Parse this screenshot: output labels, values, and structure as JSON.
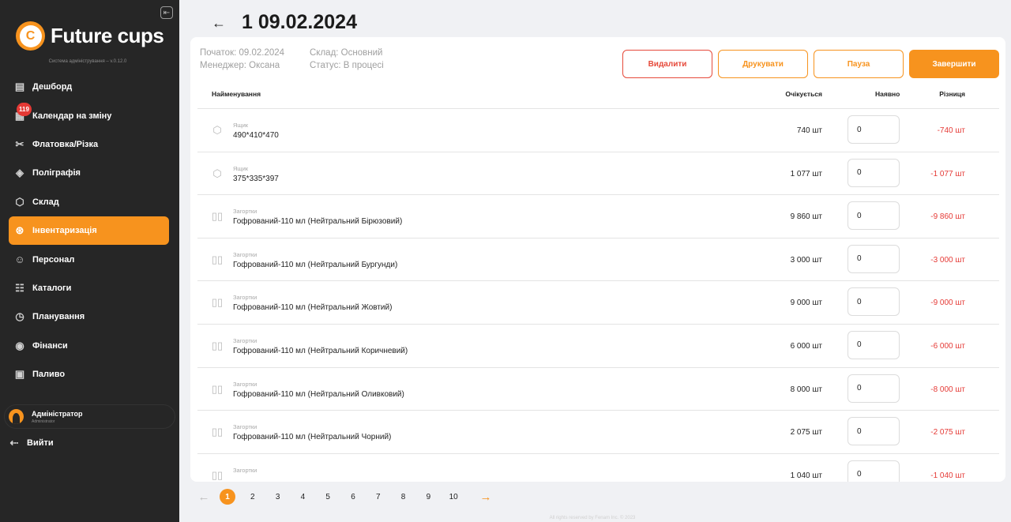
{
  "app": {
    "logo_text": "Future cups",
    "subtitle": "Система адміністрування – v.0.12.0"
  },
  "sidebar": {
    "items": [
      {
        "label": "Дешборд",
        "icon": "dashboard-icon",
        "active": false
      },
      {
        "label": "Календар на зміну",
        "icon": "calendar-icon",
        "active": false,
        "badge": "119"
      },
      {
        "label": "Флатовка/Різка",
        "icon": "scissors-icon",
        "active": false
      },
      {
        "label": "Поліграфія",
        "icon": "print-drop-icon",
        "active": false
      },
      {
        "label": "Склад",
        "icon": "box-icon",
        "active": false
      },
      {
        "label": "Інвентаризація",
        "icon": "inventory-icon",
        "active": true
      },
      {
        "label": "Персонал",
        "icon": "people-icon",
        "active": false
      },
      {
        "label": "Каталоги",
        "icon": "catalog-icon",
        "active": false
      },
      {
        "label": "Планування",
        "icon": "planning-icon",
        "active": false
      },
      {
        "label": "Фінанси",
        "icon": "finance-icon",
        "active": false
      },
      {
        "label": "Паливо",
        "icon": "fuel-icon",
        "active": false
      }
    ],
    "user": {
      "name": "Адміністратор",
      "role": "Administrator"
    },
    "logout_label": "Вийти"
  },
  "header": {
    "title": "1 09.02.2024"
  },
  "meta": {
    "start": "Початок: 09.02.2024",
    "manager": "Менеджер: Оксана",
    "warehouse": "Склад: Основний",
    "status": "Статус: В процесі"
  },
  "actions": {
    "delete": "Видалити",
    "print": "Друкувати",
    "pause": "Пауза",
    "finish": "Завершити"
  },
  "table": {
    "headers": {
      "name": "Найменування",
      "expected": "Очікується",
      "available": "Наявно",
      "diff": "Різниця"
    },
    "rows": [
      {
        "icon": "box-icon",
        "category": "Ящик",
        "name": "490*410*470",
        "expected": "740 шт",
        "available": "0",
        "diff": "-740 шт"
      },
      {
        "icon": "box-icon",
        "category": "Ящик",
        "name": "375*335*397",
        "expected": "1 077 шт",
        "available": "0",
        "diff": "-1 077 шт"
      },
      {
        "icon": "blanks-icon",
        "category": "Загортки",
        "name": "Гофрований-110 мл (Нейтральний Бірюзовий)",
        "expected": "9 860 шт",
        "available": "0",
        "diff": "-9 860 шт"
      },
      {
        "icon": "blanks-icon",
        "category": "Загортки",
        "name": "Гофрований-110 мл (Нейтральний Бургунди)",
        "expected": "3 000 шт",
        "available": "0",
        "diff": "-3 000 шт"
      },
      {
        "icon": "blanks-icon",
        "category": "Загортки",
        "name": "Гофрований-110 мл (Нейтральний Жовтий)",
        "expected": "9 000 шт",
        "available": "0",
        "diff": "-9 000 шт"
      },
      {
        "icon": "blanks-icon",
        "category": "Загортки",
        "name": "Гофрований-110 мл (Нейтральний Коричневий)",
        "expected": "6 000 шт",
        "available": "0",
        "diff": "-6 000 шт"
      },
      {
        "icon": "blanks-icon",
        "category": "Загортки",
        "name": "Гофрований-110 мл (Нейтральний Оливковий)",
        "expected": "8 000 шт",
        "available": "0",
        "diff": "-8 000 шт"
      },
      {
        "icon": "blanks-icon",
        "category": "Загортки",
        "name": "Гофрований-110 мл (Нейтральний Чорний)",
        "expected": "2 075 шт",
        "available": "0",
        "diff": "-2 075 шт"
      },
      {
        "icon": "blanks-icon",
        "category": "Загортки",
        "name": "",
        "expected": "1 040 шт",
        "available": "0",
        "diff": "-1 040 шт"
      }
    ]
  },
  "pagination": {
    "pages": [
      "1",
      "2",
      "3",
      "4",
      "5",
      "6",
      "7",
      "8",
      "9",
      "10"
    ],
    "current": "1"
  },
  "footer": "All rights reserved by Fenam Inc. © 2023",
  "colors": {
    "accent": "#f7931e",
    "danger": "#e53935",
    "sidebar_bg": "#262626"
  }
}
